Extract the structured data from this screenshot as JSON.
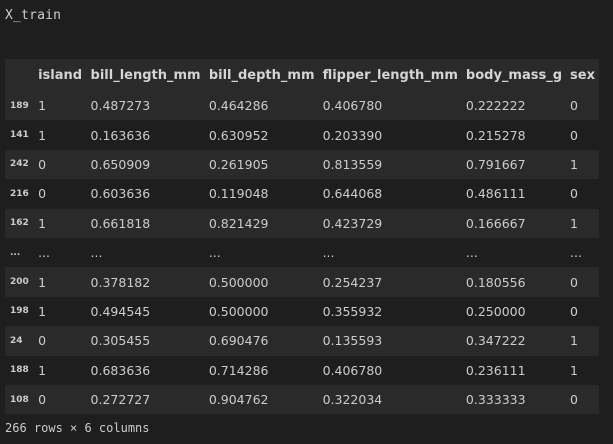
{
  "cell_code": "X_train",
  "table": {
    "columns": [
      "island",
      "bill_length_mm",
      "bill_depth_mm",
      "flipper_length_mm",
      "body_mass_g",
      "sex"
    ],
    "rows": [
      {
        "index": "189",
        "cells": [
          "1",
          "0.487273",
          "0.464286",
          "0.406780",
          "0.222222",
          "0"
        ]
      },
      {
        "index": "141",
        "cells": [
          "1",
          "0.163636",
          "0.630952",
          "0.203390",
          "0.215278",
          "0"
        ]
      },
      {
        "index": "242",
        "cells": [
          "0",
          "0.650909",
          "0.261905",
          "0.813559",
          "0.791667",
          "1"
        ]
      },
      {
        "index": "216",
        "cells": [
          "0",
          "0.603636",
          "0.119048",
          "0.644068",
          "0.486111",
          "0"
        ]
      },
      {
        "index": "162",
        "cells": [
          "1",
          "0.661818",
          "0.821429",
          "0.423729",
          "0.166667",
          "1"
        ]
      },
      {
        "index": "...",
        "cells": [
          "...",
          "...",
          "...",
          "...",
          "...",
          "..."
        ]
      },
      {
        "index": "200",
        "cells": [
          "1",
          "0.378182",
          "0.500000",
          "0.254237",
          "0.180556",
          "0"
        ]
      },
      {
        "index": "198",
        "cells": [
          "1",
          "0.494545",
          "0.500000",
          "0.355932",
          "0.250000",
          "0"
        ]
      },
      {
        "index": "24",
        "cells": [
          "0",
          "0.305455",
          "0.690476",
          "0.135593",
          "0.347222",
          "1"
        ]
      },
      {
        "index": "188",
        "cells": [
          "1",
          "0.683636",
          "0.714286",
          "0.406780",
          "0.236111",
          "1"
        ]
      },
      {
        "index": "108",
        "cells": [
          "0",
          "0.272727",
          "0.904762",
          "0.322034",
          "0.333333",
          "0"
        ]
      }
    ]
  },
  "footer": "266 rows × 6 columns"
}
